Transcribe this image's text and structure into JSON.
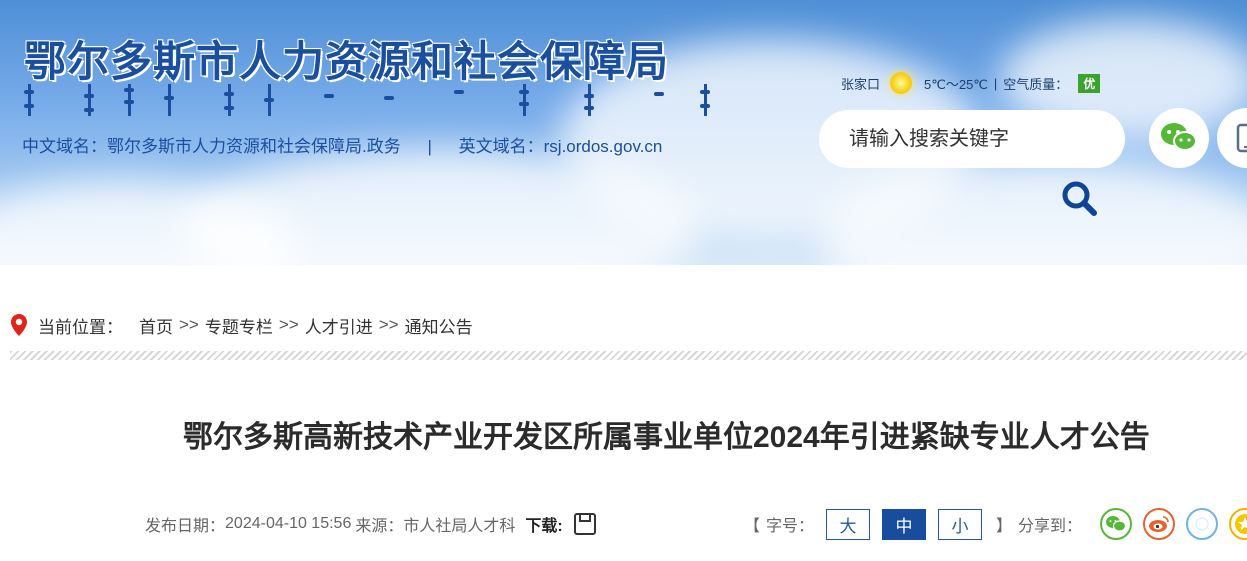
{
  "header": {
    "title": "鄂尔多斯市人力资源和社会保障局",
    "domain_cn_label": "中文域名：鄂尔多斯市人力资源和社会保障局.政务",
    "separator": "|",
    "domain_en_label": "英文域名：rsj.ordos.gov.cn",
    "weather": {
      "city": "张家口",
      "temp": "5℃～25℃",
      "divider": "|",
      "air_label": "空气质量：",
      "air_value": "优"
    },
    "search": {
      "placeholder": "请输入搜索关键字"
    }
  },
  "breadcrumb": {
    "label": "当前位置：",
    "items": [
      "首页",
      "专题专栏",
      "人才引进",
      "通知公告"
    ],
    "arrow": ">>"
  },
  "article": {
    "title": "鄂尔多斯高新技术产业开发区所属事业单位2024年引进紧缺专业人才公告",
    "publish_label": "发布日期：",
    "publish_date": "2024-04-10 15:56",
    "source_label": "来源：",
    "source": "市人社局人才科",
    "download_label": "下载:"
  },
  "tools": {
    "bracket_open": "【",
    "font_label": "字号：",
    "font_sizes": [
      "大",
      "中",
      "小"
    ],
    "active_font": "中",
    "bracket_close": "】",
    "share_label": "分享到："
  },
  "colors": {
    "brand_blue": "#1a4e9e",
    "active_button": "#174d9c",
    "aqi_green": "#3aa32f",
    "wechat_green": "#55b837",
    "weibo_red": "#e6632d",
    "pin_red": "#e2231a"
  },
  "icons": {
    "location": "map-pin-icon",
    "wechat": "wechat-icon",
    "mobile": "mobile-icon",
    "search": "search-icon",
    "download": "download-icon",
    "share": [
      "wechat-share-icon",
      "weibo-share-icon",
      "qzone-share-icon",
      "favorite-share-icon"
    ]
  }
}
